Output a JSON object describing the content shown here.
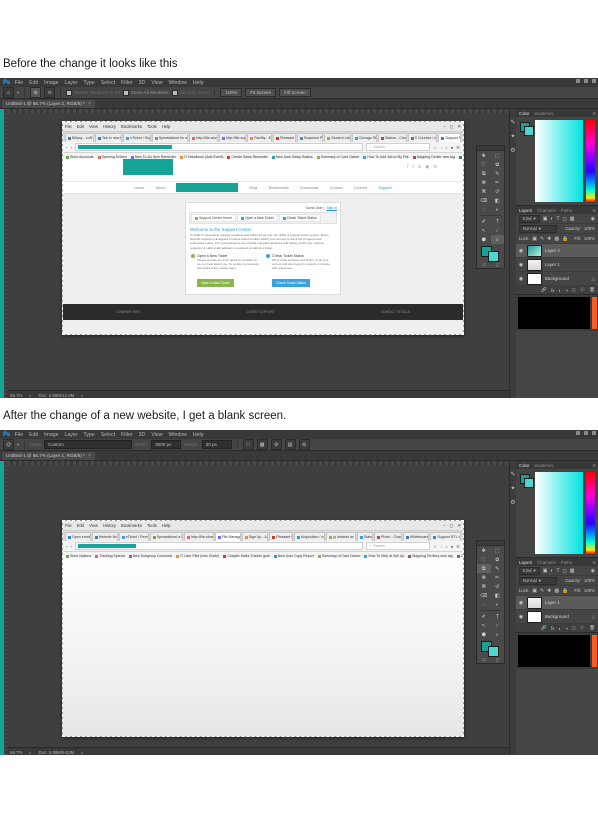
{
  "captions": {
    "before": "Before the change it looks like this",
    "after": "After the change of a new website, I get a blank screen."
  },
  "photoshop": {
    "app_logo": "Ps",
    "menu": [
      "File",
      "Edit",
      "Image",
      "Layer",
      "Type",
      "Select",
      "Filter",
      "3D",
      "View",
      "Window",
      "Help"
    ],
    "window_controls": [
      "minimize",
      "maximize",
      "close"
    ],
    "window_one": {
      "document_tab": "Untitled-1 @ 66.7% (Layer 2, RGB/8) *",
      "tab_close": "×",
      "options_bar": {
        "tool_icon": "zoom-tool",
        "tool_dropdown": "▾",
        "zoom_in_icon": "zoom-in",
        "zoom_out_icon": "zoom-out",
        "resize_windows_label": "Resize Windows to Fit",
        "zoom_all_label": "Zoom All Windows",
        "scrubby_label": "Scrubby Zoom",
        "btn_100": "100%",
        "btn_fit": "Fit Screen",
        "btn_fill": "Fill Screen"
      },
      "status": {
        "zoom": "66.7%",
        "doc": "Doc: 5.98M/12.0M",
        "arrow": "▸"
      },
      "layers_panel": {
        "tabs": [
          "Layers",
          "Channels",
          "Paths"
        ],
        "active_tab": "Layers",
        "filter_label": "Kind",
        "filter_caret": "▾",
        "blend_mode": "Normal",
        "blend_caret": "▾",
        "opacity_label": "Opacity:",
        "opacity_value": "100%",
        "lock_label": "Lock:",
        "fill_label": "Fill:",
        "fill_value": "100%",
        "layers": [
          {
            "name": "Layer 2",
            "visible": "◉",
            "thumb": "teal",
            "active": true,
            "lock": ""
          },
          {
            "name": "Layer 1",
            "visible": "◉",
            "thumb": "grey",
            "active": false,
            "lock": ""
          },
          {
            "name": "Background",
            "visible": "◉",
            "thumb": "white",
            "active": false,
            "lock": "△"
          }
        ],
        "footer_icons": [
          "link-icon",
          "fx-icon",
          "mask-icon",
          "adjustment-icon",
          "group-icon",
          "new-layer-icon",
          "trash-icon"
        ]
      },
      "color_panel": {
        "tabs": [
          "Color",
          "Swatches"
        ],
        "active_tab": "Color"
      }
    },
    "window_two": {
      "document_tab": "Untitled-1 @ 66.7% (Layer 1, RGB/8) *",
      "tab_close": "×",
      "options_bar": {
        "tool_icon": "crop-tool",
        "tool_dropdown": "▾",
        "ratio_label": "Ratio",
        "ratio_value": "Custom",
        "ratio_caret": "▾",
        "width_label": "Width:",
        "width_value": "3000 px",
        "height_label": "Height:",
        "height_value": "30 px",
        "icons": [
          "straighten-icon",
          "overlay-icon",
          "crop-settings-icon",
          "delete-pixels-icon",
          "gear-icon"
        ]
      },
      "status": {
        "zoom": "66.7%",
        "doc": "Doc: 5.98M/9.03M",
        "arrow": "▸"
      },
      "layers_panel": {
        "tabs": [
          "Layers",
          "Channels",
          "Paths"
        ],
        "active_tab": "Layers",
        "filter_label": "Kind",
        "filter_caret": "▾",
        "blend_mode": "Normal",
        "blend_caret": "▾",
        "opacity_label": "Opacity:",
        "opacity_value": "100%",
        "lock_label": "Lock:",
        "fill_label": "Fill:",
        "fill_value": "100%",
        "layers": [
          {
            "name": "Layer 1",
            "visible": "◉",
            "thumb": "grey",
            "active": true,
            "lock": ""
          },
          {
            "name": "Background",
            "visible": "◉",
            "thumb": "white",
            "active": false,
            "lock": "△"
          }
        ],
        "footer_icons": [
          "link-icon",
          "fx-icon",
          "mask-icon",
          "adjustment-icon",
          "group-icon",
          "new-layer-icon",
          "trash-icon"
        ]
      },
      "color_panel": {
        "tabs": [
          "Color",
          "Swatches"
        ],
        "active_tab": "Color"
      }
    },
    "tools": [
      "move-tool",
      "marquee-tool",
      "lasso-tool",
      "quick-select-tool",
      "crop-tool",
      "eyedropper-tool",
      "healing-brush-tool",
      "brush-tool",
      "clone-stamp-tool",
      "history-brush-tool",
      "eraser-tool",
      "gradient-tool",
      "blur-tool",
      "dodge-tool",
      "pen-tool",
      "type-tool",
      "path-select-tool",
      "line-tool",
      "shape-tool",
      "zoom-tool"
    ],
    "tool_modes": [
      "quick-mask-icon",
      "screen-mode-icon"
    ]
  },
  "browser_one": {
    "menu": [
      "File",
      "Edit",
      "View",
      "History",
      "Bookmarks",
      "Tools",
      "Help"
    ],
    "tabs": [
      "Billpay - coNT=NT",
      "Tab to new ticket",
      "eTicket / Support",
      "Spreadsheet for a Notice",
      "http://file-store.org",
      "http://file-support",
      "Facility - Email",
      "Pleasant Hill",
      "Snapshot Portal",
      "Student List Pro",
      "Chicago Street",
      "Station - Changes",
      "S Courses / emails",
      "Support RTL"
    ],
    "active_tab": "Support RTL",
    "url_text": "",
    "search_placeholder": "Search",
    "bookmarks": [
      "Store Accounts",
      "Opening Screen",
      "New To-Do Item Reminder",
      "IT Handbook (Add Event)",
      "Create Sales Reminder",
      "New User Setup Basics",
      "Summary of Card Owner",
      "How To Add Job to My File",
      "Mapping Center new tag",
      "Enterprise Journal Accounts",
      "jQuery Model",
      "Card Calendar - Terms",
      "Website Learning ac. Cal"
    ],
    "site": {
      "nav": [
        "Home",
        "About",
        "",
        "Blog",
        "Testimonials",
        "Downloads",
        "Contact",
        "Careers",
        "Support"
      ],
      "active_nav": "Support",
      "signin_text": "Guest User |",
      "signin_link": "Sign In",
      "tabs": [
        "Support Center Home",
        "Open a New Ticket",
        "Check Ticket Status"
      ],
      "active_tab": "Support Center Home",
      "heading": "Welcome to the Support Center",
      "body": "In order to streamline support requests and better serve you, we utilize a support ticket system. Every support request is assigned a unique ticket number which you can use to track the progress and responses online. For your reference we provide complete archives and history of all your support requests. A valid email address is required to submit a ticket.",
      "col_left": {
        "title": "Open a New Ticket",
        "text": "Please provide as much detail as possible so we can best assist you. To update a previously submitted ticket, please login.",
        "button": "Open a New Ticket"
      },
      "col_right": {
        "title": "Check Ticket Status",
        "text": "We provide archives and history of all your current and past support requests complete with responses.",
        "button": "Check Ticket Status"
      },
      "footer": [
        "COMPANY INFO",
        "LATEST SUPPORT",
        "CONTACT DETAILS"
      ]
    }
  },
  "browser_two": {
    "menu": [
      "File",
      "Edit",
      "View",
      "History",
      "Bookmarks",
      "Tools",
      "Help"
    ],
    "tabs": [
      "Open email list",
      "Website Notice",
      "eTicket / Reminder",
      "Spreadsheet a Notice",
      "http://file-store.org",
      "File Manager 2",
      "Sign Up - About",
      "Pleasant Info",
      "Acquisition / course",
      "jq Intranet ac Time",
      "Status",
      "Photo - Changes",
      "Whiteboard pro",
      "Support RTL online"
    ],
    "active_tab": "File Manager 2",
    "url_text": "",
    "search_placeholder": "Search",
    "bookmarks": [
      "Store Nations",
      "Tracking Spread",
      "New Subgroup Comment",
      "IT User Pilot (new Guide)",
      "Chapter Sales Tracker goal",
      "New User Copy Report",
      "Summary of Card Owner",
      "How To Help at Sell Up",
      "Mapping Territory new tag",
      "Case Application Database",
      "All jQuery Printer",
      "Cases Scribers / Terms",
      "ATT Site by homepage - Cal"
    ],
    "content": "blank"
  }
}
